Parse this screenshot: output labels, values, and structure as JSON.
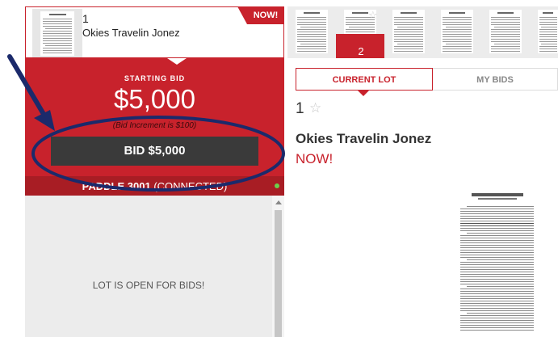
{
  "lot_strip": {
    "current": {
      "number": "1",
      "name": "Okies Travelin Jonez",
      "badge": "NOW!"
    },
    "active_number": "2"
  },
  "bid_panel": {
    "starting_label": "STARTING BID",
    "starting_amount": "$5,000",
    "increment_text": "(Bid Increment is $100)",
    "bid_button_label": "BID $5,000",
    "paddle_label": "PADDLE 3001",
    "paddle_status": "(CONNECTED)"
  },
  "status": {
    "message": "LOT IS OPEN FOR BIDS!"
  },
  "tabs": {
    "current_lot": "CURRENT LOT",
    "my_bids": "MY BIDS"
  },
  "lot_detail": {
    "number": "1",
    "name": "Okies Travelin Jonez",
    "status": "NOW!"
  },
  "icons": {
    "star": "star-outline-icon",
    "connection": "connection-status-dot-icon",
    "annotation": "arrow-icon"
  },
  "colors": {
    "accent": "#c8222c",
    "button": "#3a3a3a",
    "connected": "#6cd04a",
    "annotation": "#1b2a6b"
  }
}
